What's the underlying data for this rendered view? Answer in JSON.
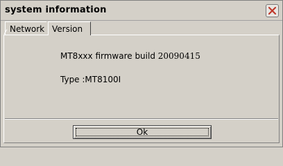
{
  "window": {
    "title": "system information"
  },
  "tabs": [
    {
      "label": "Network"
    },
    {
      "label": "Version"
    }
  ],
  "version": {
    "firmware_prefix": "MT8xxx firmware build ",
    "firmware_build": "20090415",
    "type_line": "Type :MT8100I"
  },
  "buttons": {
    "ok_label": "Ok"
  },
  "icons": {
    "close": "close-icon"
  },
  "colors": {
    "background": "#d4d0c8",
    "close_x": "#c0392b"
  }
}
